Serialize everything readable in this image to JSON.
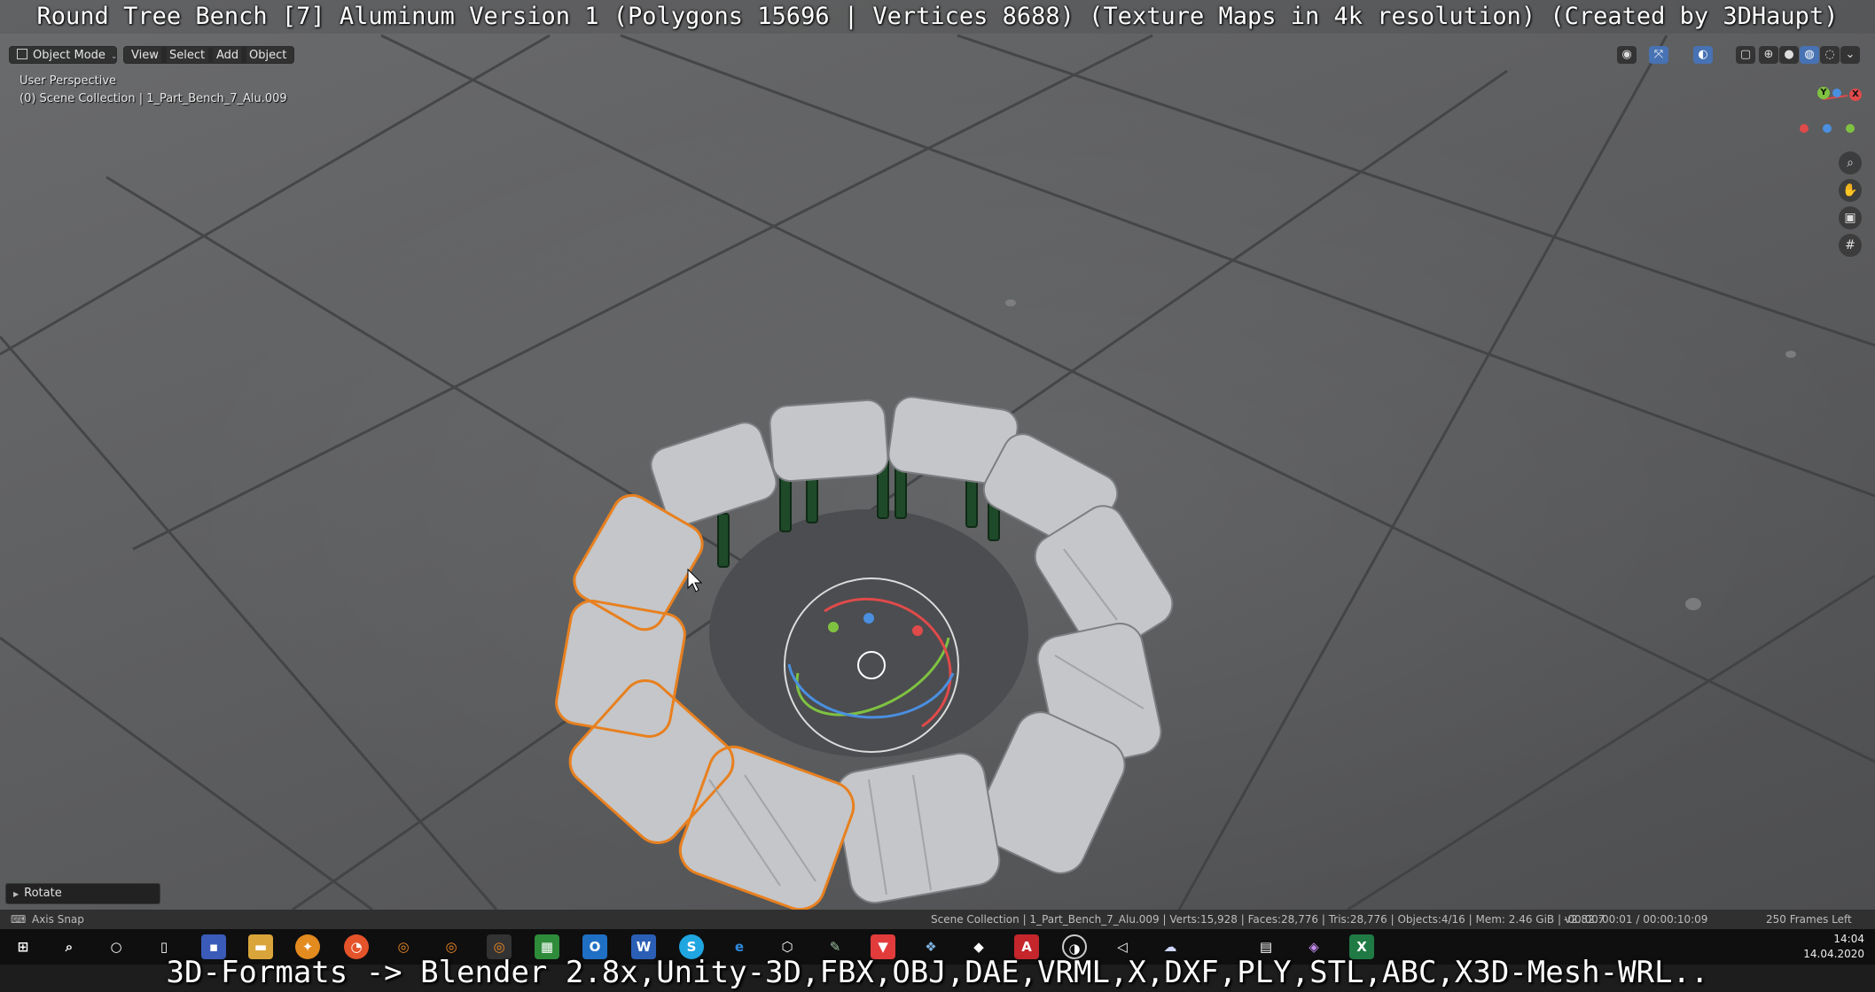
{
  "title_caption": "Round Tree Bench [7] Aluminum Version 1 (Polygons 15696 | Vertices 8688) (Texture Maps in 4k resolution) (Created by 3DHaupt)",
  "header": {
    "mode_label": "Object Mode",
    "menu": [
      "View",
      "Select",
      "Add",
      "Object"
    ]
  },
  "viewport": {
    "perspective_label": "User Perspective",
    "collection_label": "(0) Scene Collection | 1_Part_Bench_7_Alu.009"
  },
  "gizmo": {
    "y_label": "Y",
    "x_label": "X"
  },
  "operator_panel": {
    "label": "Rotate"
  },
  "status_bar": {
    "left_label": "Axis Snap",
    "scene_info": "Scene Collection | 1_Part_Bench_7_Alu.009 | Verts:15,928 | Faces:28,776 | Tris:28,776 | Objects:4/16 | Mem: 2.46 GiB | v2.82.7",
    "timecode": "-00:00:00:01 / 00:00:10:09",
    "frames_left": "250 Frames Left"
  },
  "taskbar": {
    "icons": [
      "windows-start-icon",
      "search-icon",
      "cortana-icon",
      "task-view-icon",
      "save-disk-icon",
      "folder-icon",
      "app-orange-icon",
      "firefox-icon",
      "blender-icon",
      "blender-icon-2",
      "blender-icon-3",
      "spreadsheet-icon",
      "outlook-icon",
      "word-icon",
      "skype-icon",
      "edge-icon",
      "cube-app-icon",
      "tool-app-icon",
      "vivaldi-icon",
      "seal-app-icon",
      "unity-app-icon",
      "acrobat-icon",
      "obs-icon",
      "visual-studio-icon",
      "cloud-app-icon",
      "calculator-icon",
      "maps-app-icon",
      "excel-icon"
    ],
    "time": "14:04",
    "date": "14.04.2020"
  },
  "bottom_caption": "3D-Formats -> Blender 2.8x,Unity-3D,FBX,OBJ,DAE,VRML,X,DXF,PLY,STL,ABC,X3D-Mesh-WRL.."
}
